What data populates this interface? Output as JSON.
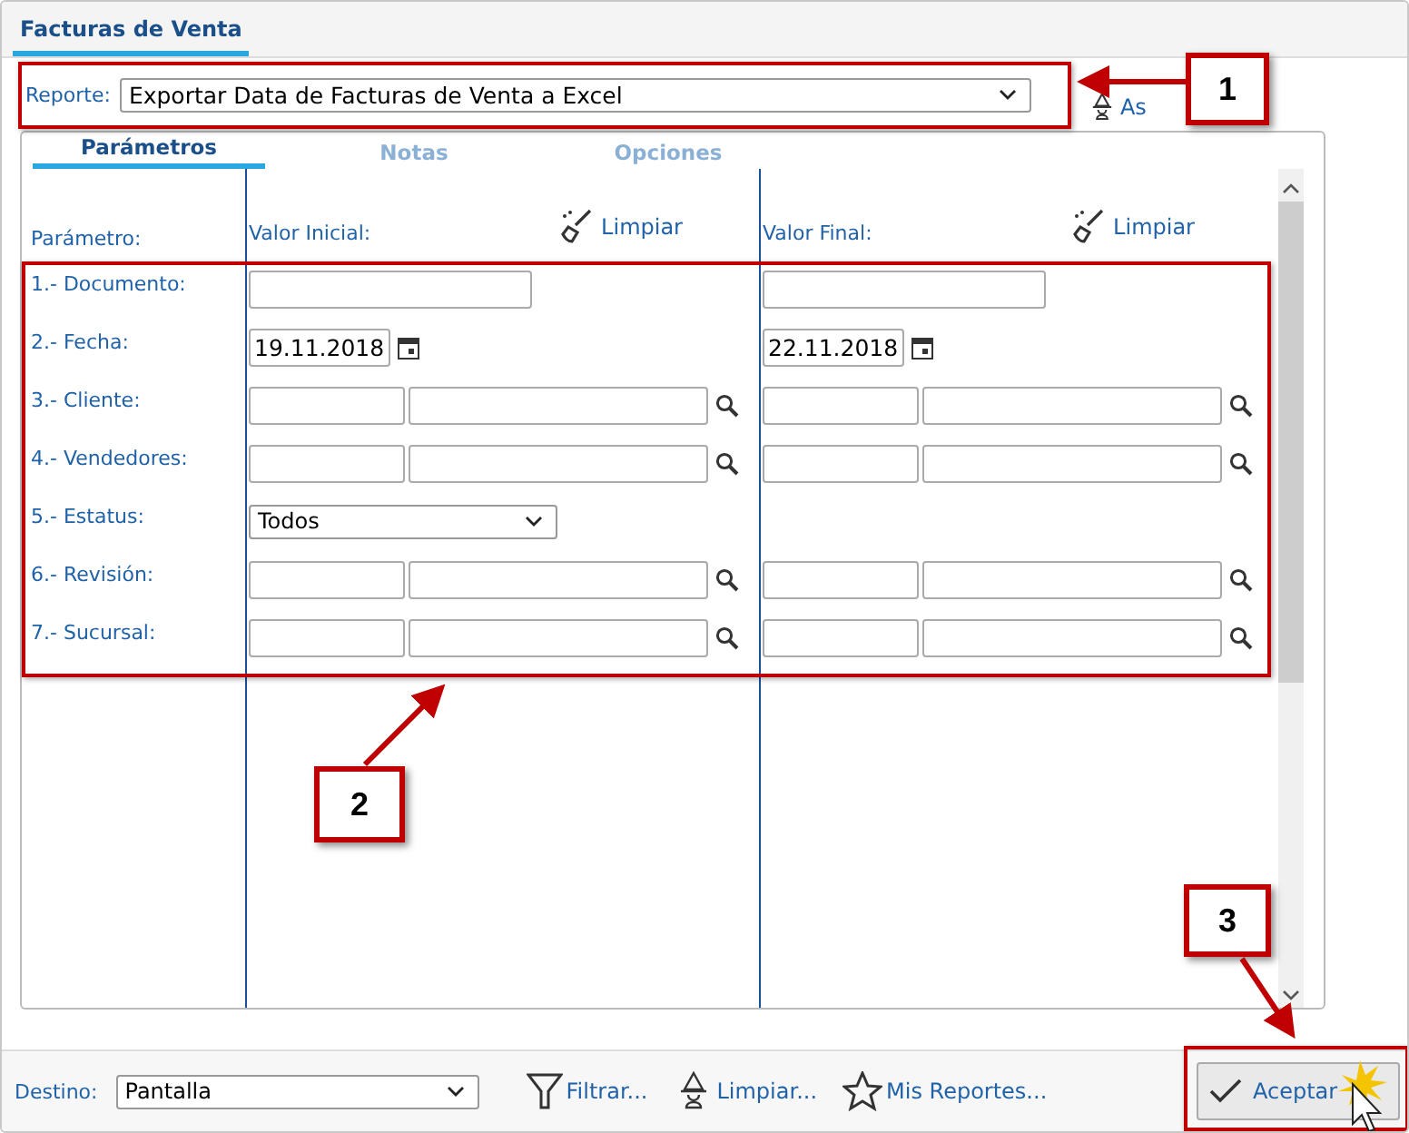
{
  "window_tab": {
    "label": "Facturas de Venta",
    "selected": true
  },
  "report": {
    "label": "Reporte:",
    "value": "Exportar Data de Facturas de Venta a Excel"
  },
  "assistant_button": {
    "label": "As"
  },
  "tabs": [
    {
      "label": "Parámetros",
      "selected": true
    },
    {
      "label": "Notas",
      "selected": false
    },
    {
      "label": "Opciones",
      "selected": false
    }
  ],
  "columns": {
    "parameter": "Parámetro:",
    "initial": "Valor Inicial:",
    "initial_clear": "Limpiar",
    "final": "Valor Final:",
    "final_clear": "Limpiar"
  },
  "parameters": [
    {
      "label": "1.- Documento:",
      "kind": "text"
    },
    {
      "label": "2.- Fecha:",
      "kind": "date",
      "initial": "19.11.2018",
      "final": "22.11.2018"
    },
    {
      "label": "3.- Cliente:",
      "kind": "lookup"
    },
    {
      "label": "4.- Vendedores:",
      "kind": "lookup"
    },
    {
      "label": "5.- Estatus:",
      "kind": "select",
      "initial": "Todos"
    },
    {
      "label": "6.- Revisión:",
      "kind": "lookup"
    },
    {
      "label": "7.- Sucursal:",
      "kind": "lookup"
    }
  ],
  "footer": {
    "destination_label": "Destino:",
    "destination": "Pantalla",
    "buttons": [
      {
        "label": "Filtrar...",
        "kind": "filter"
      },
      {
        "label": "Limpiar...",
        "kind": "wizard"
      },
      {
        "label": "Mis Reportes...",
        "kind": "star"
      }
    ],
    "accept": "Aceptar"
  },
  "callouts": [
    "1",
    "2",
    "3"
  ]
}
